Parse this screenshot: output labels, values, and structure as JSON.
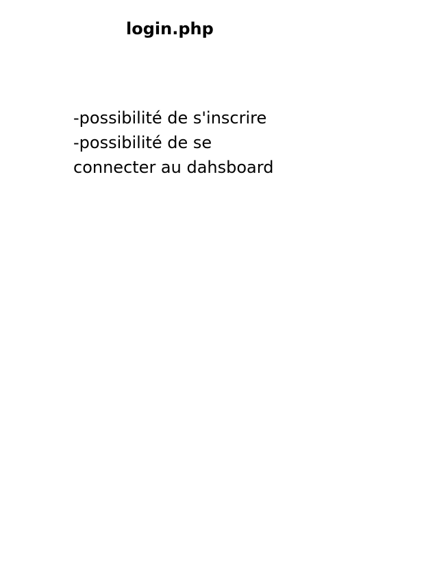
{
  "page": {
    "title": "login.php",
    "notes": [
      "-possibilité de s'inscrire",
      "-possibilité de se",
      "connecter au dahsboard"
    ]
  }
}
